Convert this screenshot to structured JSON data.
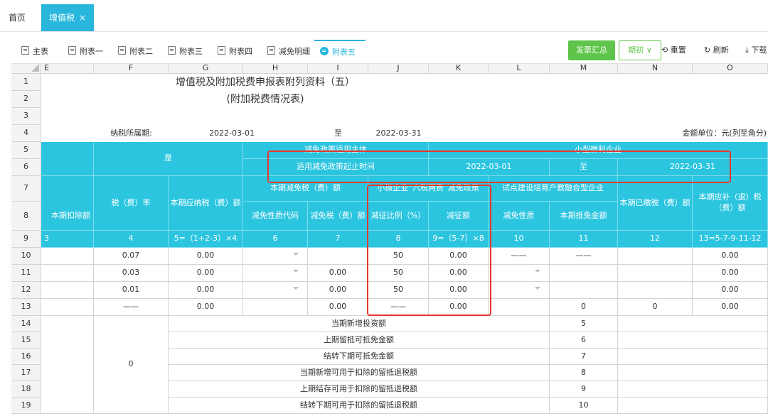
{
  "topbar": {
    "home": "首页",
    "vat_tab": "增值税",
    "close": "×"
  },
  "subtabs": [
    {
      "label": "主表"
    },
    {
      "label": "附表一"
    },
    {
      "label": "附表二"
    },
    {
      "label": "附表三"
    },
    {
      "label": "附表四"
    },
    {
      "label": "减免明细"
    },
    {
      "label": "附表五"
    }
  ],
  "toolbar": {
    "invoice_summary": "发票汇总",
    "initial": "期初",
    "reset": "重置",
    "refresh": "刷新",
    "download": "下载"
  },
  "columns": [
    "E",
    "F",
    "G",
    "H",
    "I",
    "J",
    "K",
    "L",
    "M",
    "N",
    "O"
  ],
  "rows": [
    "1",
    "2",
    "3",
    "4",
    "5",
    "6",
    "7",
    "8",
    "9",
    "10",
    "11",
    "12",
    "13",
    "14",
    "15",
    "16",
    "17",
    "18",
    "19"
  ],
  "sheet": {
    "title": "增值税及附加税费申报表附列资料（五）",
    "subtitle": "(附加税费情况表)",
    "period_label": "纳税所属期:",
    "period_start": "2022-03-01",
    "period_to": "至",
    "period_end": "2022-03-31",
    "unit": "金额单位：元(列至角分)",
    "r56": {
      "yes": "是",
      "subject_label": "减免政策适用主体",
      "subject_value": "小型微利企业",
      "time_label": "适用减免政策起止时间",
      "time_start": "2022-03-01",
      "time_to": "至",
      "time_end": "2022-03-31"
    },
    "headers": {
      "e8": "本期扣除额",
      "rate": "税（费）率",
      "payable": "本期应纳税（费）额",
      "reduction_group": "本期减免税（费）额",
      "reduction_code": "减免性质代码",
      "reduction_amount": "减免税（费）额",
      "small_group": "小微企业“六税两费”减免政策",
      "small_ratio": "减征比例（%）",
      "small_amount": "减征额",
      "pilot_group": "试点建设培育产教融合型企业",
      "pilot_nature": "减免性质",
      "pilot_amount": "本期抵免金额",
      "paid": "本期已缴税（费）额",
      "supplement": "本期应补（退）税（费）额"
    },
    "r9": [
      "3",
      "4",
      "5=（1+2-3）×4",
      "6",
      "7",
      "8",
      "9=（5-7）×8",
      "10",
      "11",
      "12",
      "13=5-7-9-11-12"
    ],
    "data": [
      {
        "f": "0.07",
        "g": "0.00",
        "i": "",
        "j": "50",
        "k": "0.00",
        "l": "——",
        "m": "——",
        "n": "",
        "o": "0.00"
      },
      {
        "f": "0.03",
        "g": "0.00",
        "i": "0.00",
        "j": "50",
        "k": "0.00",
        "l": "",
        "m": "",
        "n": "",
        "o": "0.00"
      },
      {
        "f": "0.01",
        "g": "0.00",
        "i": "0.00",
        "j": "50",
        "k": "0.00",
        "l": "",
        "m": "",
        "n": "",
        "o": "0.00"
      },
      {
        "f": "——",
        "g": "0.00",
        "i": "0.00",
        "j": "——",
        "k": "0.00",
        "l": "",
        "m": "0",
        "n": "0",
        "o": "0.00"
      }
    ],
    "lower": {
      "f15": "0",
      "labels": [
        "当期新增投资额",
        "上期留抵可抵免金额",
        "结转下期可抵免金额",
        "当期新增可用于扣除的留抵退税额",
        "上期结存可用于扣除的留抵退税额",
        "结转下期可用于扣除的留抵退税额"
      ],
      "codes": [
        "5",
        "6",
        "7",
        "8",
        "9",
        "10"
      ]
    }
  }
}
